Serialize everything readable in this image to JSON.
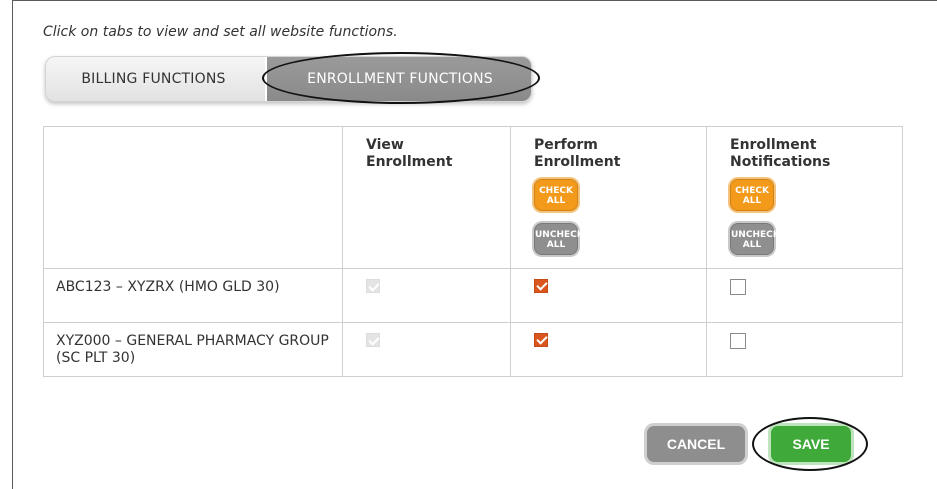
{
  "instructions": "Click on tabs to view and set all website functions.",
  "tabs": [
    {
      "label": "BILLING FUNCTIONS",
      "active": false
    },
    {
      "label": "ENROLLMENT FUNCTIONS",
      "active": true
    }
  ],
  "table": {
    "columns": [
      "",
      "View Enrollment",
      "Perform Enrollment",
      "Enrollment Notifications"
    ],
    "check_all_label": "CHECK ALL",
    "uncheck_all_label": "UNCHECK ALL",
    "rows": [
      {
        "label": "ABC123 – XYZRX (HMO GLD 30)",
        "view": "checked-disabled",
        "perform": "checked",
        "notify": "unchecked"
      },
      {
        "label": "XYZ000 – GENERAL PHARMACY GROUP (SC PLT 30)",
        "view": "checked-disabled",
        "perform": "checked",
        "notify": "unchecked"
      }
    ]
  },
  "actions": {
    "cancel_label": "CANCEL",
    "save_label": "SAVE"
  },
  "colors": {
    "check_all": "#f39a1b",
    "uncheck_all": "#8f8f8f",
    "checkbox_checked": "#d9561f",
    "save": "#3fa93a",
    "cancel": "#8e8e8e",
    "active_tab": "#8a8a8a"
  }
}
